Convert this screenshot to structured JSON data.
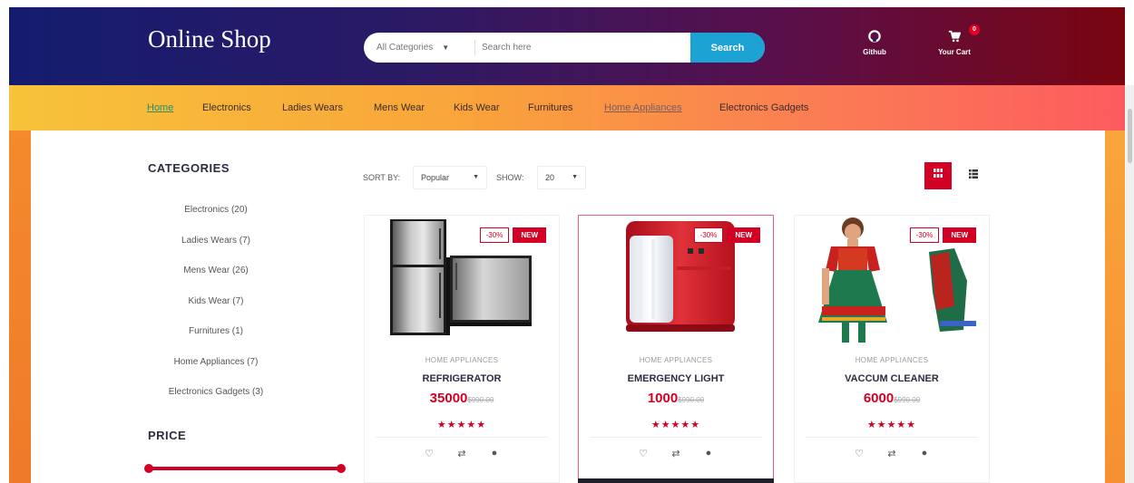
{
  "header": {
    "logo": "Online Shop",
    "search": {
      "category": "All Categories",
      "placeholder": "Search here",
      "button": "Search"
    },
    "github_label": "Github",
    "cart_label": "Your Cart",
    "cart_count": "0"
  },
  "nav": {
    "items": [
      "Home",
      "Electronics",
      "Ladies Wears",
      "Mens Wear",
      "Kids Wear",
      "Furnitures",
      "Home Appliances",
      "Electronics Gadgets"
    ]
  },
  "sidebar": {
    "categories_heading": "CATEGORIES",
    "categories": [
      {
        "label": "Electronics (20)"
      },
      {
        "label": "Ladies Wears (7)"
      },
      {
        "label": "Mens Wear (26)"
      },
      {
        "label": "Kids Wear (7)"
      },
      {
        "label": "Furnitures (1)"
      },
      {
        "label": "Home Appliances (7)"
      },
      {
        "label": "Electronics Gadgets (3)"
      }
    ],
    "price_heading": "PRICE"
  },
  "toolbar": {
    "sort_label": "SORT BY:",
    "sort_value": "Popular",
    "show_label": "SHOW:",
    "show_value": "20"
  },
  "products": [
    {
      "category": "HOME APPLIANCES",
      "name": "REFRIGERATOR",
      "price": "35000",
      "old_price": "$990.00",
      "sale": "-30%",
      "new": "NEW",
      "stars": "★★★★★"
    },
    {
      "category": "HOME APPLIANCES",
      "name": "EMERGENCY LIGHT",
      "price": "1000",
      "old_price": "$990.00",
      "sale": "-30%",
      "new": "NEW",
      "stars": "★★★★★"
    },
    {
      "category": "HOME APPLIANCES",
      "name": "VACCUM CLEANER",
      "price": "6000",
      "old_price": "$990.00",
      "sale": "-30%",
      "new": "NEW",
      "stars": "★★★★★"
    }
  ],
  "colors": {
    "accent": "#d10024",
    "search_button": "#1ca3d4",
    "header_start": "#141c6e",
    "header_end": "#7a0510",
    "nav_start": "#f7c33a",
    "nav_end": "#fc5b5e"
  }
}
